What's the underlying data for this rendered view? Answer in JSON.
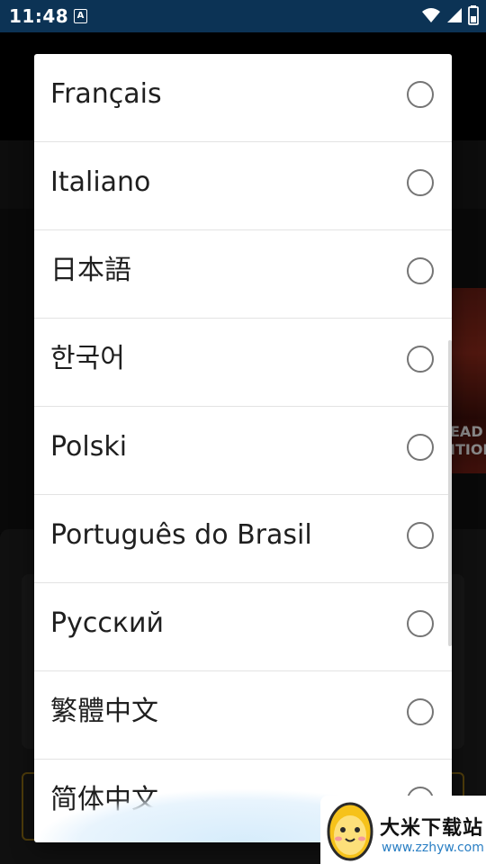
{
  "status_bar": {
    "time": "11:48",
    "notification_icon": "a-notification-icon",
    "icons": [
      "wifi-icon",
      "signal-icon",
      "battery-icon"
    ]
  },
  "background_app": {
    "poster_text": "EAD\nITION"
  },
  "dialog": {
    "languages": [
      {
        "label": "Français",
        "selected": false
      },
      {
        "label": "Italiano",
        "selected": false
      },
      {
        "label": "日本語",
        "selected": false
      },
      {
        "label": "한국어",
        "selected": false
      },
      {
        "label": "Polski",
        "selected": false
      },
      {
        "label": "Português do Brasil",
        "selected": false
      },
      {
        "label": "Русский",
        "selected": false
      },
      {
        "label": "繁體中文",
        "selected": false
      },
      {
        "label": "简体中文",
        "selected": false
      }
    ]
  },
  "watermark": {
    "title": "大米下载站",
    "url": "www.zzhyw.com",
    "logo_icon": "egg-mascot-icon"
  },
  "colors": {
    "status_bar_bg": "#0c3355",
    "radio_border": "#757575",
    "dialog_bg": "#ffffff",
    "watermark_url": "#2a7fc4"
  }
}
